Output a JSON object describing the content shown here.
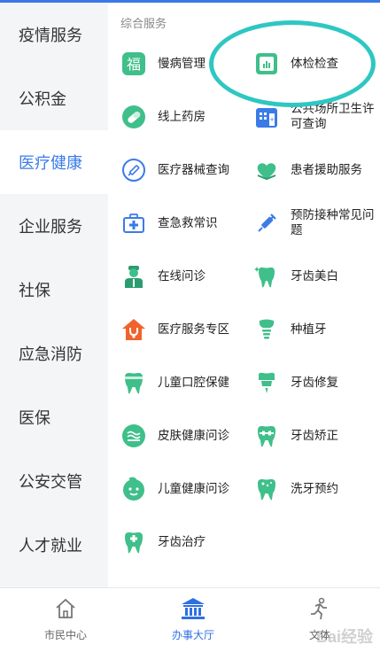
{
  "colors": {
    "accent": "#3b7be8",
    "green": "#3fbf8a",
    "teal": "#2ec7c2",
    "orange": "#f0632e",
    "sidebar_bg": "#f4f5f7"
  },
  "sidebar": {
    "items": [
      {
        "label": "疫情服务"
      },
      {
        "label": "公积金"
      },
      {
        "label": "医疗健康",
        "active": true
      },
      {
        "label": "企业服务"
      },
      {
        "label": "社保"
      },
      {
        "label": "应急消防"
      },
      {
        "label": "医保"
      },
      {
        "label": "公安交管"
      },
      {
        "label": "人才就业"
      }
    ]
  },
  "main": {
    "section_title": "综合服务",
    "services": [
      {
        "label": "慢病管理",
        "icon": "fu-character-icon"
      },
      {
        "label": "体检检查",
        "icon": "report-chart-icon"
      },
      {
        "label": "线上药房",
        "icon": "pill-icon"
      },
      {
        "label": "公共场所卫生许可查询",
        "icon": "building-icon"
      },
      {
        "label": "医疗器械查询",
        "icon": "syringe-circle-icon"
      },
      {
        "label": "患者援助服务",
        "icon": "heart-hands-icon"
      },
      {
        "label": "查急救常识",
        "icon": "first-aid-kit-icon"
      },
      {
        "label": "预防接种常见问题",
        "icon": "vaccine-icon"
      },
      {
        "label": "在线问诊",
        "icon": "doctor-icon"
      },
      {
        "label": "牙齿美白",
        "icon": "tooth-sparkle-icon"
      },
      {
        "label": "医疗服务专区",
        "icon": "stethoscope-house-icon"
      },
      {
        "label": "种植牙",
        "icon": "dental-implant-icon"
      },
      {
        "label": "儿童口腔保健",
        "icon": "tooth-child-icon"
      },
      {
        "label": "牙齿修复",
        "icon": "tooth-repair-icon"
      },
      {
        "label": "皮肤健康问诊",
        "icon": "skin-icon"
      },
      {
        "label": "牙齿矫正",
        "icon": "tooth-braces-icon"
      },
      {
        "label": "儿童健康问诊",
        "icon": "baby-face-icon"
      },
      {
        "label": "洗牙预约",
        "icon": "tooth-clean-icon"
      },
      {
        "label": "牙齿治疗",
        "icon": "tooth-treatment-icon"
      }
    ]
  },
  "bottom_nav": {
    "items": [
      {
        "label": "市民中心",
        "icon": "home-icon"
      },
      {
        "label": "办事大厅",
        "icon": "hall-icon",
        "active": true
      },
      {
        "label": "文体",
        "icon": "runner-icon"
      }
    ]
  },
  "watermark": "Bai经验"
}
